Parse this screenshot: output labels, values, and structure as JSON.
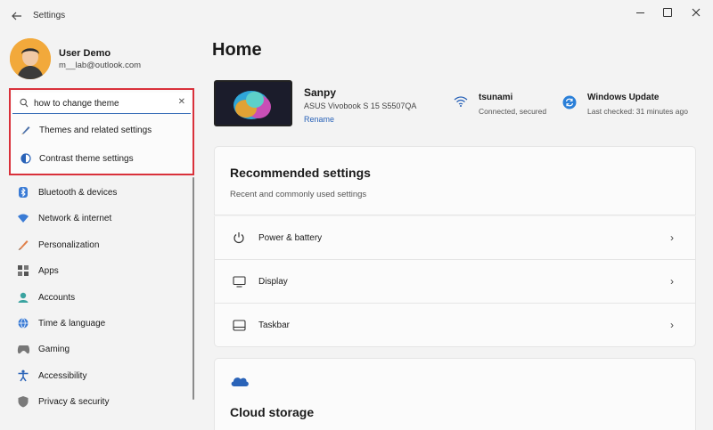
{
  "window": {
    "title": "Settings",
    "back_icon": "back-arrow-icon"
  },
  "user": {
    "name": "User Demo",
    "email": "m__lab@outlook.com"
  },
  "search": {
    "value": "how to change theme",
    "suggestions": [
      {
        "label": "Themes and related settings",
        "icon": "brush-icon"
      },
      {
        "label": "Contrast theme settings",
        "icon": "contrast-icon"
      }
    ]
  },
  "sidebar": {
    "items": [
      {
        "label": "Bluetooth & devices",
        "icon": "bluetooth-icon"
      },
      {
        "label": "Network & internet",
        "icon": "wifi-icon"
      },
      {
        "label": "Personalization",
        "icon": "brush-icon"
      },
      {
        "label": "Apps",
        "icon": "apps-icon"
      },
      {
        "label": "Accounts",
        "icon": "accounts-icon"
      },
      {
        "label": "Time & language",
        "icon": "globe-icon"
      },
      {
        "label": "Gaming",
        "icon": "gamepad-icon"
      },
      {
        "label": "Accessibility",
        "icon": "accessibility-icon"
      },
      {
        "label": "Privacy & security",
        "icon": "shield-icon"
      }
    ]
  },
  "main": {
    "title": "Home",
    "device": {
      "name": "Sanpy",
      "model": "ASUS Vivobook S 15 S5507QA",
      "rename_label": "Rename"
    },
    "network": {
      "name": "tsunami",
      "status": "Connected, secured"
    },
    "update": {
      "name": "Windows Update",
      "status": "Last checked: 31 minutes ago"
    },
    "recommended": {
      "title": "Recommended settings",
      "subtitle": "Recent and commonly used settings",
      "items": [
        {
          "label": "Power & battery",
          "icon": "power-icon"
        },
        {
          "label": "Display",
          "icon": "display-icon"
        },
        {
          "label": "Taskbar",
          "icon": "taskbar-icon"
        }
      ]
    },
    "cloud": {
      "title": "Cloud storage"
    }
  },
  "colors": {
    "accent": "#2a63b8",
    "highlight_border": "#d9303a",
    "background": "#f3f3f3"
  }
}
